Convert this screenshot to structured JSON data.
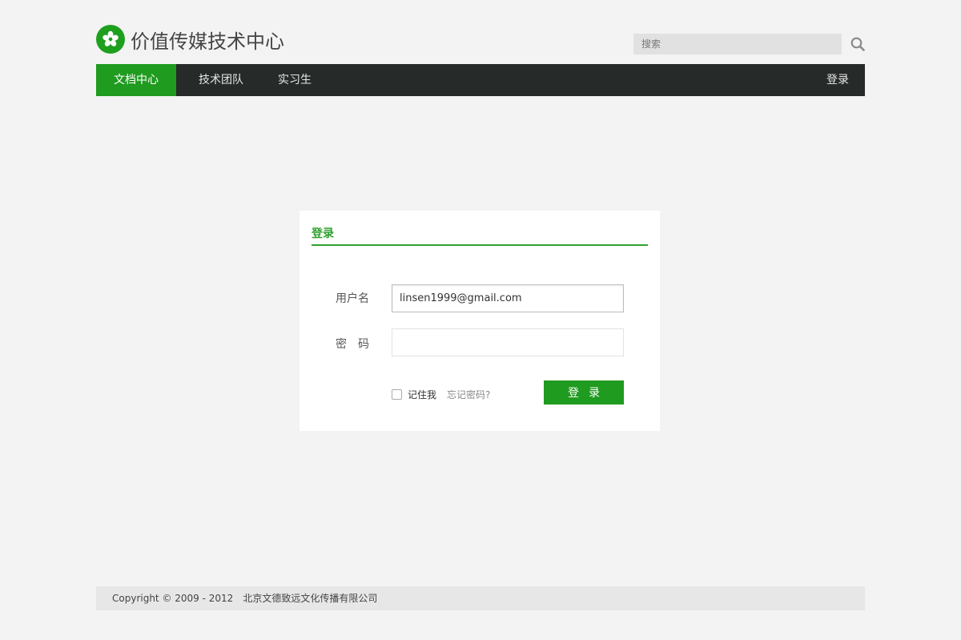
{
  "header": {
    "site_title": "价值传媒技术中心",
    "search_placeholder": "搜索",
    "search_icon": "search-icon"
  },
  "nav": {
    "items": [
      {
        "label": "文档中心",
        "active": true
      },
      {
        "label": "技术团队",
        "active": false
      },
      {
        "label": "实习生",
        "active": false
      }
    ],
    "login_label": "登录"
  },
  "login": {
    "title": "登录",
    "username_label": "用户名",
    "username_value": "linsen1999@gmail.com",
    "password_label": "密码",
    "password_value": "",
    "remember_label": "记住我",
    "remember_checked": false,
    "forgot_label": "忘记密码?",
    "submit_label": "登录"
  },
  "footer": {
    "copyright": "Copyright © 2009 - 2012",
    "company": "北京文德致远文化传播有限公司"
  },
  "colors": {
    "accent": "#1f9b1f",
    "nav_bg": "#262a29",
    "page_bg": "#f3f3f3"
  }
}
